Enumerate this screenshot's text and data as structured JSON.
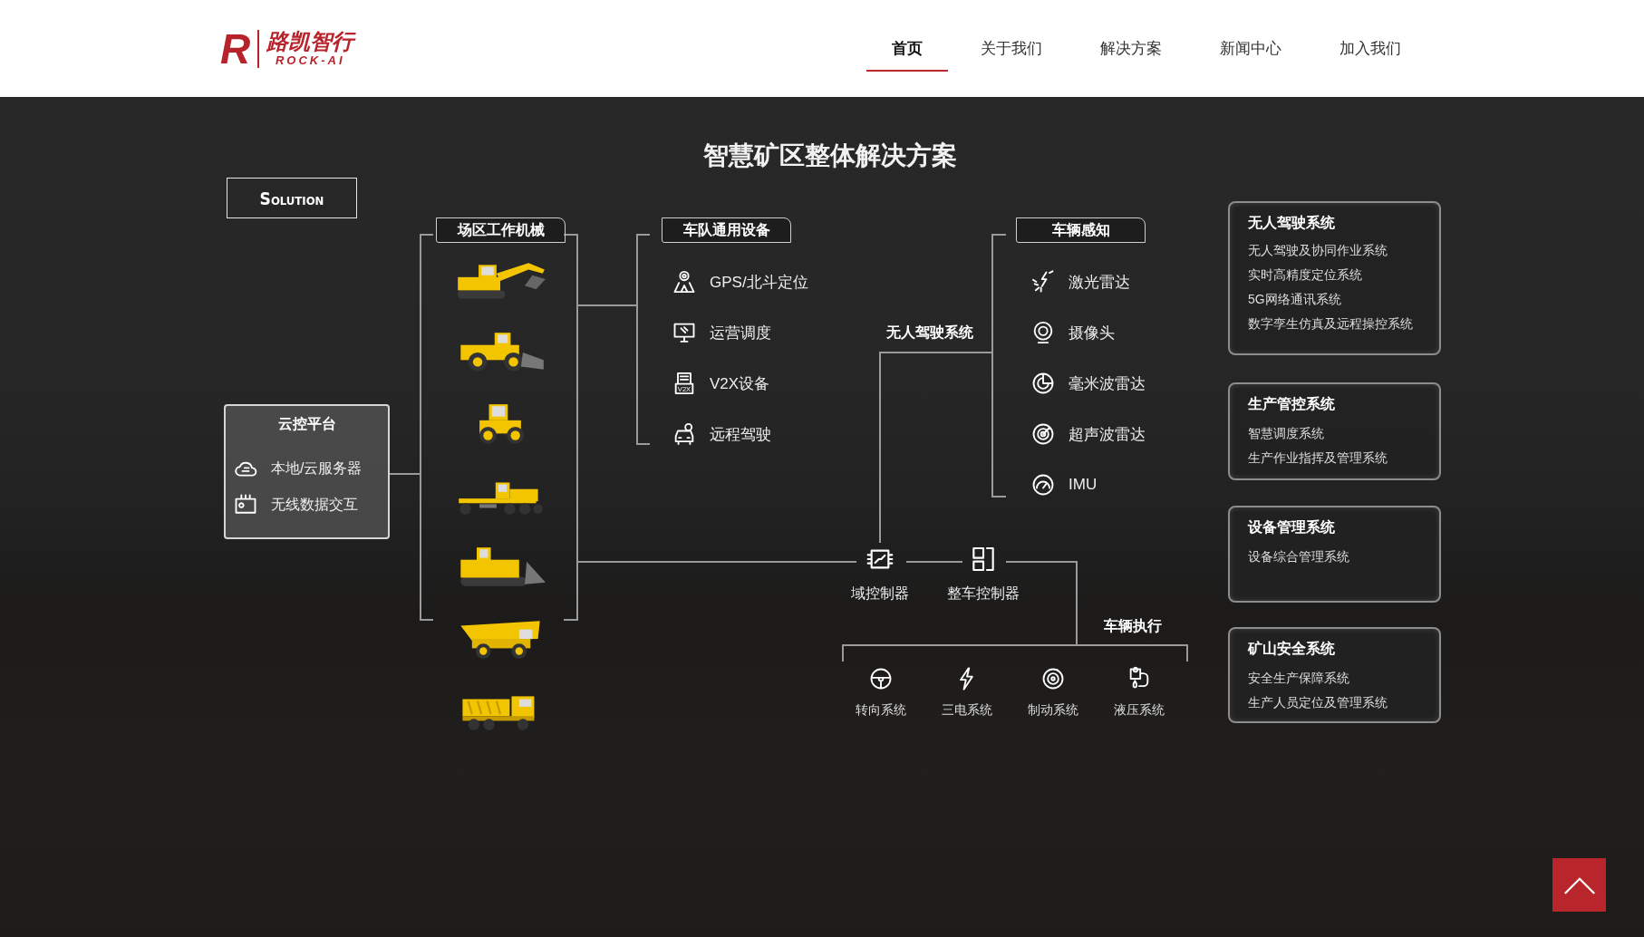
{
  "header": {
    "logo": {
      "mark": "R",
      "name": "路凯智行",
      "subtitle": "ROCK-AI"
    },
    "nav": [
      {
        "label": "首页",
        "selected": true
      },
      {
        "label": "关于我们",
        "selected": false
      },
      {
        "label": "解决方案",
        "selected": false
      },
      {
        "label": "新闻中心",
        "selected": false
      },
      {
        "label": "加入我们",
        "selected": false
      }
    ]
  },
  "diagram": {
    "title": "智慧矿区整体解决方案",
    "badge": "Solution",
    "cloud_platform": {
      "title": "云控平台",
      "items": [
        "本地/云服务器",
        "无线数据交互"
      ]
    },
    "machinery": {
      "title": "场区工作机械"
    },
    "fleet_equipment": {
      "title": "车队通用设备",
      "items": [
        {
          "label": "GPS/北斗定位"
        },
        {
          "label": "运营调度"
        },
        {
          "label": "V2X设备",
          "icon_text": "V2X"
        },
        {
          "label": "远程驾驶"
        }
      ]
    },
    "autonomous_label": "无人驾驶系统",
    "sensing": {
      "title": "车辆感知",
      "items": [
        "激光雷达",
        "摄像头",
        "毫米波雷达",
        "超声波雷达",
        "IMU"
      ]
    },
    "controllers": [
      "域控制器",
      "整车控制器"
    ],
    "execution": {
      "title": "车辆执行",
      "items": [
        "转向系统",
        "三电系统",
        "制动系统",
        "液压系统"
      ]
    },
    "systems": [
      {
        "title": "无人驾驶系统",
        "items": [
          "无人驾驶及协同作业系统",
          "实时高精度定位系统",
          "5G网络通讯系统",
          "数字孪生仿真及远程操控系统"
        ]
      },
      {
        "title": "生产管控系统",
        "items": [
          "智慧调度系统",
          "生产作业指挥及管理系统"
        ]
      },
      {
        "title": "设备管理系统",
        "items": [
          "设备综合管理系统"
        ]
      },
      {
        "title": "矿山安全系统",
        "items": [
          "安全生产保障系统",
          "生产人员定位及管理系统"
        ]
      }
    ]
  }
}
